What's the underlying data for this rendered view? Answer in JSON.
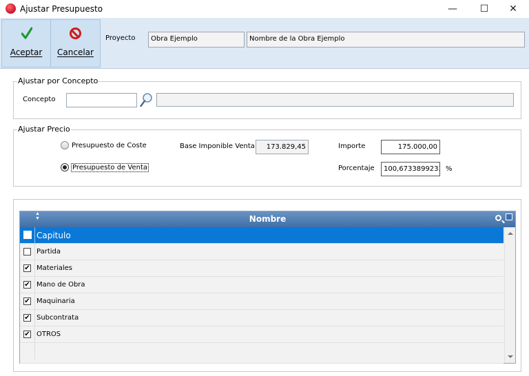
{
  "window": {
    "title": "Ajustar Presupuesto",
    "minimize_glyph": "—",
    "maximize_glyph": "☐",
    "close_glyph": "✕"
  },
  "toolbar": {
    "accept_label": "Aceptar",
    "cancel_label": "Cancelar"
  },
  "proyecto": {
    "label": "Proyecto",
    "code": "Obra Ejemplo",
    "name": "Nombre de la Obra Ejemplo"
  },
  "ajustar_concepto": {
    "title": "Ajustar por Concepto",
    "concepto_label": "Concepto",
    "concepto_value": "",
    "concepto_desc": ""
  },
  "ajustar_precio": {
    "title": "Ajustar Precio",
    "radio_coste_label": "Presupuesto de Coste",
    "radio_venta_label": "Presupuesto de Venta",
    "selected": "venta",
    "base_label": "Base Imponible Venta",
    "base_value": "173.829,45",
    "importe_label": "Importe",
    "importe_value": "175.000,00",
    "porcentaje_label": "Porcentaje",
    "porcentaje_value": "100,6733899233",
    "percent_sign": "%"
  },
  "grid": {
    "header": "Nombre",
    "rows": [
      {
        "name": "Capitulo",
        "checked": false,
        "selected": true
      },
      {
        "name": "Partida",
        "checked": false,
        "selected": false
      },
      {
        "name": "Materiales",
        "checked": true,
        "selected": false
      },
      {
        "name": "Mano de Obra",
        "checked": true,
        "selected": false
      },
      {
        "name": "Maquinaria",
        "checked": true,
        "selected": false
      },
      {
        "name": "Subcontrata",
        "checked": true,
        "selected": false
      },
      {
        "name": "OTROS",
        "checked": true,
        "selected": false
      }
    ],
    "check_glyph": "✔"
  },
  "colors": {
    "toolbar_bg": "#dde9f5",
    "header_blue": "#3f6fa8",
    "selection_blue": "#0a78d7",
    "accept_green": "#1e9a2e",
    "cancel_red": "#d21a1a"
  }
}
